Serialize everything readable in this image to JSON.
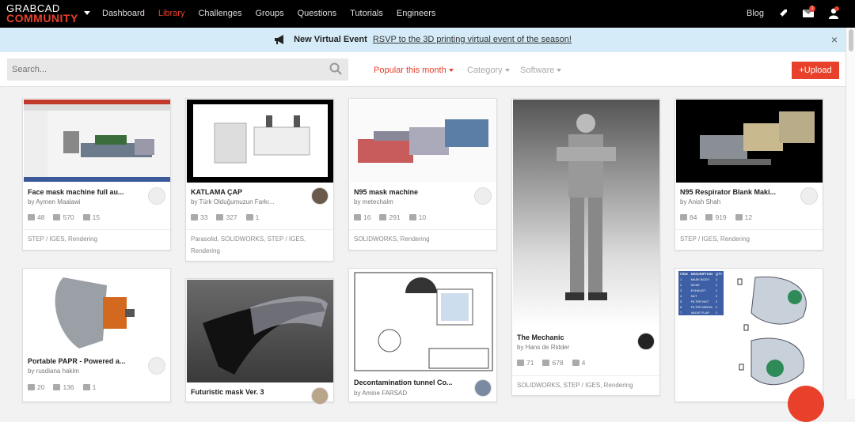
{
  "logo": {
    "line1": "GRABCAD",
    "line2": "COMMUNITY"
  },
  "nav": {
    "items": [
      "Dashboard",
      "Library",
      "Challenges",
      "Groups",
      "Questions",
      "Tutorials",
      "Engineers"
    ],
    "active": "Library",
    "blog": "Blog",
    "mail_badge": "1"
  },
  "banner": {
    "title": "New Virtual Event",
    "link": "RSVP to the 3D printing virtual event of the season!",
    "close": "×"
  },
  "toolbar": {
    "search_placeholder": "Search...",
    "popular": "Popular this month",
    "category": "Category",
    "software": "Software",
    "upload": "+Upload"
  },
  "colors": {
    "accent": "#e8402a",
    "banner_bg": "#d5ecf8",
    "topbar": "#000000"
  },
  "cards": [
    {
      "title": "Face mask machine full au...",
      "author": "by Aymen Maalawi",
      "likes": "48",
      "downloads": "570",
      "comments": "15",
      "tags": "STEP / IGES, Rendering"
    },
    {
      "title": "KATLAMA ÇAP",
      "author": "by Türk Olduğumuzun Farkı...",
      "likes": "33",
      "downloads": "327",
      "comments": "1",
      "tags": "Parasolid, SOLIDWORKS, STEP / IGES, Rendering"
    },
    {
      "title": "N95 mask machine",
      "author": "by metechalm",
      "likes": "16",
      "downloads": "291",
      "comments": "10",
      "tags": "SOLIDWORKS, Rendering"
    },
    {
      "title": "The Mechanic",
      "author": "by Hans de Ridder",
      "likes": "71",
      "downloads": "678",
      "comments": "4",
      "tags": "SOLIDWORKS, STEP / IGES, Rendering"
    },
    {
      "title": "N95 Respirator Blank Maki...",
      "author": "by Anish Shah",
      "likes": "84",
      "downloads": "919",
      "comments": "12",
      "tags": "STEP / IGES, Rendering"
    },
    {
      "title": "Portable PAPR - Powered a...",
      "author": "by rusdiana hakim",
      "likes": "20",
      "downloads": "136",
      "comments": "1"
    },
    {
      "title": "Futuristic mask Ver. 3"
    },
    {
      "title": "Decontamination tunnel Co...",
      "author": "by Amine FARSAD"
    }
  ],
  "table": {
    "headers": [
      "ITEM",
      "DESCRIPTION",
      "QTY"
    ],
    "rows": [
      [
        "1",
        "MASK BODY",
        "1"
      ],
      [
        "2",
        "NOSE",
        "2"
      ],
      [
        "3",
        "EXHAUST",
        "1"
      ],
      [
        "4",
        "NUT",
        "3"
      ],
      [
        "5",
        "FILTER NUT",
        "2"
      ],
      [
        "6",
        "FILTER MEDIA",
        "2"
      ],
      [
        "7",
        "VALVE FLAP",
        "1"
      ]
    ]
  }
}
